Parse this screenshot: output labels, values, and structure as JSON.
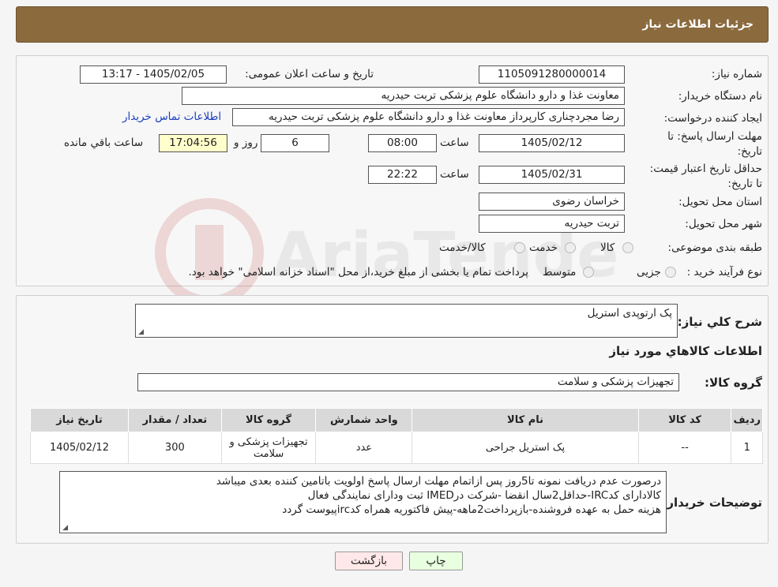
{
  "header": {
    "title": "جزئیات اطلاعات نیاز"
  },
  "form": {
    "need_number_label": "شماره نیاز:",
    "need_number": "1105091280000014",
    "announce_label": "تاریخ و ساعت اعلان عمومی:",
    "announce_value": "1405/02/05 - 13:17",
    "buyer_org_label": "نام دستگاه خریدار:",
    "buyer_org": "معاونت غذا و دارو   دانشگاه علوم پزشکی تربت حیدریه",
    "creator_label": "ایجاد کننده درخواست:",
    "creator": "رضا مجردچناری کارپرداز معاونت غذا و دارو   دانشگاه علوم پزشکی تربت حیدریه",
    "contact_link": "اطلاعات تماس خریدار",
    "deadline_label": "مهلت ارسال پاسخ: تا تاریخ:",
    "deadline_date": "1405/02/12",
    "time_label": "ساعت",
    "deadline_time": "08:00",
    "days_value": "6",
    "days_label": "روز و",
    "remaining_time": "17:04:56",
    "remaining_label": "ساعت باقي مانده",
    "validity_label": "حداقل تاریخ اعتبار قیمت: تا تاریخ:",
    "validity_date": "1405/02/31",
    "validity_time": "22:22",
    "province_label": "استان محل تحویل:",
    "province": "خراسان رضوی",
    "city_label": "شهر محل تحویل:",
    "city": "تربت حیدریه",
    "category_label": "طبقه بندی موضوعی:",
    "category_options": [
      "کالا",
      "خدمت",
      "کالا/خدمت"
    ],
    "process_label": "نوع فرآیند خرید :",
    "process_options": [
      "جزیی",
      "متوسط"
    ],
    "process_note": "پرداخت تمام یا بخشی از مبلغ خرید،از محل \"اسناد خزانه اسلامی\" خواهد بود."
  },
  "details": {
    "summary_label": "شرح کلي نياز:",
    "summary": "پک ارتوپدی استریل",
    "goods_info_title": "اطلاعات کالاهاي مورد نياز",
    "goods_group_label": "گروه کالا:",
    "goods_group": "تجهیزات پزشکی و سلامت"
  },
  "table": {
    "headers": [
      "رديف",
      "کد کالا",
      "نام کالا",
      "واحد شمارش",
      "گروه کالا",
      "تعداد / مقدار",
      "تاریخ نیاز"
    ],
    "rows": [
      [
        "1",
        "--",
        "پک استریل جراحی",
        "عدد",
        "تجهیزات پزشکی و سلامت",
        "300",
        "1405/02/12"
      ]
    ]
  },
  "notes": {
    "label": "توضیحات خریدار:",
    "lines": [
      "درصورت عدم دریافت نمونه تا5روز پس ازاتمام مهلت ارسال پاسخ اولویت باتامین کننده بعدی میباشد",
      "کالادارای کدIRC-حداقل2سال انقضا -شرکت درIMED ثبت ودارای نمایندگی فعال",
      "هزینه حمل به عهده فروشنده-بازپرداخت2ماهه-پیش فاکتوریه همراه کدircپیوست گردد"
    ]
  },
  "buttons": {
    "print": "چاپ",
    "back": "بازگشت"
  },
  "watermark": {
    "text": "AriaTender.neT"
  },
  "colors": {
    "titlebar": "#8b6a3e",
    "link": "#1a3fbf",
    "remaining_bg": "#ffffcc",
    "print_bg": "#e8ffe0",
    "back_bg": "#ffe8e8"
  }
}
